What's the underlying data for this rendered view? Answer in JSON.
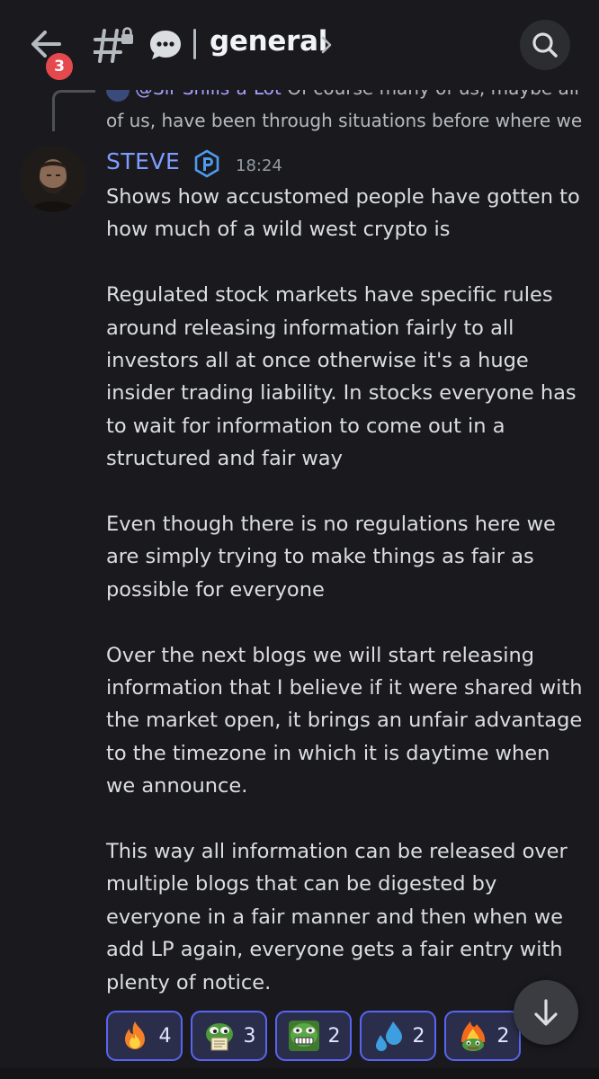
{
  "header": {
    "back_badge": "3",
    "channel_name": "general"
  },
  "reply_reference": {
    "mention": "@Sir Shills-a-Lot",
    "text_line1": "Of course many of us, maybe all",
    "text_line2": "of us, have been through situations before where we"
  },
  "message": {
    "author": "STEVE",
    "timestamp": "18:24",
    "paragraphs": [
      "Shows how accustomed people have gotten to how much of a wild west crypto is",
      "Regulated stock markets have specific rules around releasing information fairly to all investors all at once otherwise it's a huge insider trading liability. In stocks everyone has to wait for information to come out in a structured and fair way",
      "Even though there is no regulations here we are simply trying to make things as fair as possible for everyone",
      "Over the next blogs we will start releasing information that I believe if it were shared with the market open, it brings an unfair advantage to the timezone in which it is daytime when we announce.",
      "This way all information can be released over multiple blogs that can be digested by everyone in a fair manner and then when we add LP again, everyone gets a fair entry with plenty of notice."
    ]
  },
  "reactions": [
    {
      "icon": "fire-emoji-icon",
      "count": "4"
    },
    {
      "icon": "pepe-reading-emoji-icon",
      "count": "3"
    },
    {
      "icon": "pepe-grimace-emoji-icon",
      "count": "2"
    },
    {
      "icon": "sweat-droplets-emoji-icon",
      "count": "2"
    },
    {
      "icon": "pepe-fire-emoji-icon",
      "count": "2"
    }
  ],
  "colors": {
    "background": "#1a1a1e",
    "author": "#7f9cff",
    "mention": "#a7a0ff",
    "reaction_border": "#5865f2",
    "badge": "#e5484d"
  }
}
